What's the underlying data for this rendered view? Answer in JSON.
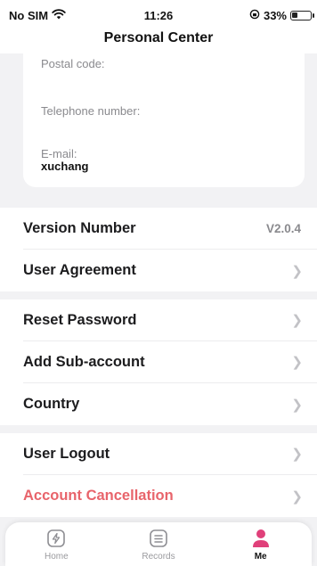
{
  "status_bar": {
    "carrier": "No SIM",
    "time": "11:26",
    "battery_percent": "33%",
    "battery_level": 0.33
  },
  "header": {
    "title": "Personal Center"
  },
  "profile": {
    "postal_code_label": "Postal code:",
    "telephone_label": "Telephone number:",
    "email_label": "E-mail:",
    "email_value": "xuchanɡ"
  },
  "settings": {
    "version_label": "Version Number",
    "version_value": "V2.0.4",
    "user_agreement": "User Agreement",
    "reset_password": "Reset Password",
    "add_sub_account": "Add Sub-account",
    "country": "Country",
    "user_logout": "User Logout",
    "account_cancellation": "Account Cancellation"
  },
  "tab_bar": {
    "tabs": [
      {
        "label": "Home",
        "icon": "home-bolt-icon"
      },
      {
        "label": "Records",
        "icon": "records-icon"
      },
      {
        "label": "Me",
        "icon": "person-icon",
        "active": true
      }
    ]
  },
  "colors": {
    "accent": "#e0407a",
    "danger": "#e8646b",
    "background": "#f2f2f4"
  }
}
